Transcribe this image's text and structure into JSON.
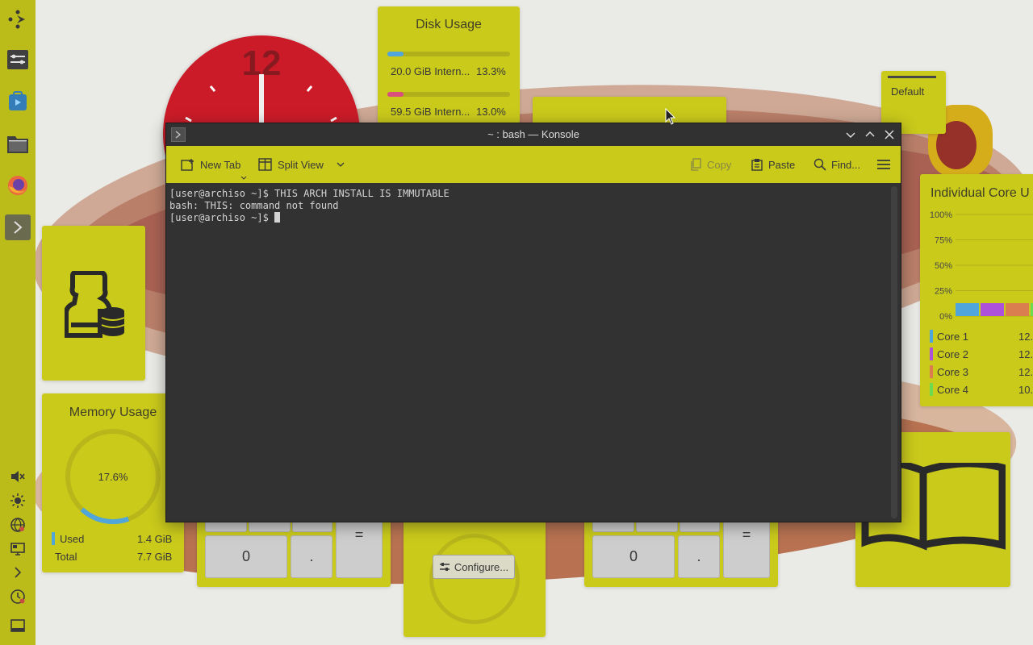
{
  "konsole": {
    "title": "~ : bash — Konsole",
    "toolbar": {
      "new_tab": "New Tab",
      "split_view": "Split View",
      "copy": "Copy",
      "paste": "Paste",
      "find": "Find..."
    },
    "terminal_lines": [
      "[user@archiso ~]$ THIS ARCH INSTALL IS IMMUTABLE",
      "bash: THIS: command not found",
      "[user@archiso ~]$ "
    ]
  },
  "disk_usage": {
    "title": "Disk Usage",
    "rows": [
      {
        "label": "20.0 GiB Intern...",
        "percent_text": "13.3%",
        "fraction": 0.133,
        "color": "#3d9bd6"
      },
      {
        "label": "59.5 GiB Intern...",
        "percent_text": "13.0%",
        "fraction": 0.13,
        "color": "#d63d6e"
      }
    ]
  },
  "activity": {
    "label": "Default"
  },
  "memory": {
    "title": "Memory Usage",
    "percent_text": "17.6%",
    "fraction": 0.176,
    "ring_color": "#3d9bd6",
    "legend": [
      {
        "label": "Used",
        "value": "1.4 GiB",
        "color": "#3d9bd6"
      },
      {
        "label": "Total",
        "value": "7.7 GiB",
        "color": ""
      }
    ]
  },
  "cpu": {
    "title": "Individual Core U",
    "y_ticks": [
      "100%",
      "75%",
      "50%",
      "25%",
      "0%"
    ],
    "cores": [
      {
        "label": "Core 1",
        "value": "12.",
        "color": "#3d9bd6"
      },
      {
        "label": "Core 2",
        "value": "12.",
        "color": "#a43dd6"
      },
      {
        "label": "Core 3",
        "value": "12.",
        "color": "#d6703d"
      },
      {
        "label": "Core 4",
        "value": "10.",
        "color": "#5ed63d"
      }
    ]
  },
  "clock": {
    "numeral": "12"
  },
  "calculator_left": {
    "keys": [
      "=",
      "0",
      "."
    ]
  },
  "calculator_right": {
    "keys": [
      "=",
      "0",
      "."
    ]
  },
  "configure_widget": {
    "button_label": "Configure..."
  },
  "colors": {
    "panel": "#b4b400",
    "widget": "#c4c400",
    "terminal_bg": "#1b1b1b"
  }
}
